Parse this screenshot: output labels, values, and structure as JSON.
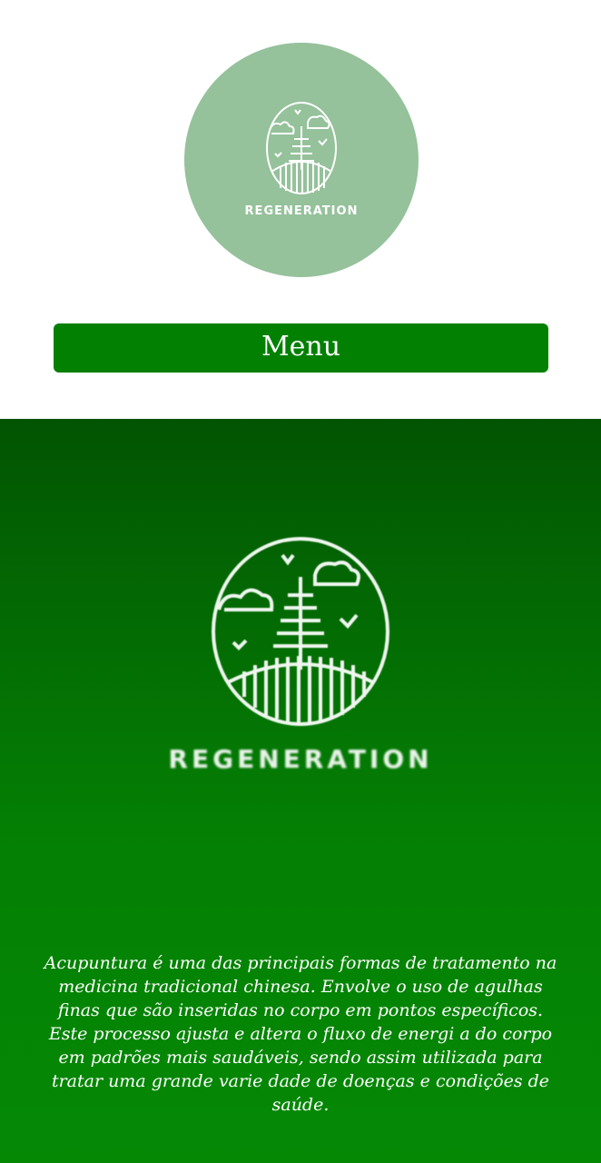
{
  "header": {
    "logo_text": "REGENERATION",
    "logo_icon": "tree-landscape-emblem-icon",
    "logo_circle_color": "#95c19b"
  },
  "menu": {
    "label": "Menu",
    "color": "#028002"
  },
  "hero": {
    "logo_icon": "tree-landscape-emblem-icon",
    "logo_text": "REGENERATION",
    "description": "Acupuntura é uma das principais formas de tratamento na medicina tradicional chinesa. Envolve o uso de agulhas finas que são inseridas no corpo em pontos específicos. Este processo ajusta e altera o fluxo de energi a do corpo em padrões mais saudáveis, sendo assim utilizada para tratar uma grande varie dade de doenças e condições de saúde.",
    "gradient_top": "#025402",
    "gradient_bottom": "#058905"
  }
}
